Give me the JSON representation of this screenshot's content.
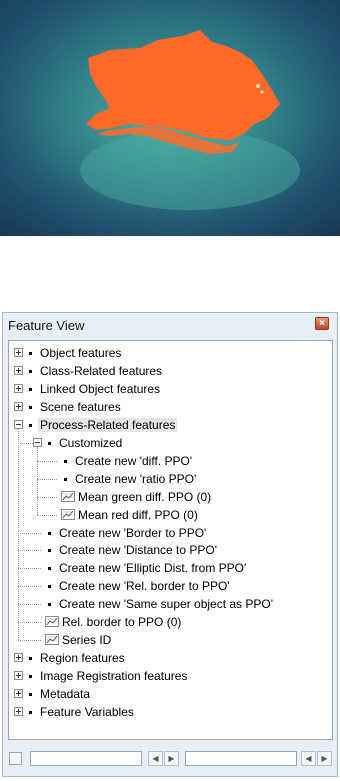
{
  "window": {
    "title": "Feature View",
    "close_icon": "close-icon"
  },
  "tree": {
    "items": [
      {
        "label": "Object features",
        "level": 0,
        "expander": "plus",
        "icon": "bullet"
      },
      {
        "label": "Class-Related features",
        "level": 0,
        "expander": "plus",
        "icon": "bullet"
      },
      {
        "label": "Linked Object features",
        "level": 0,
        "expander": "plus",
        "icon": "bullet"
      },
      {
        "label": "Scene features",
        "level": 0,
        "expander": "plus",
        "icon": "bullet"
      },
      {
        "label": "Process-Related features",
        "level": 0,
        "expander": "minus",
        "icon": "bullet",
        "highlighted": true
      },
      {
        "label": "Customized",
        "level": 1,
        "expander": "minus",
        "icon": "bullet"
      },
      {
        "label": "Create new 'diff. PPO'",
        "level": 2,
        "icon": "bullet"
      },
      {
        "label": "Create new 'ratio PPO'",
        "level": 2,
        "icon": "bullet"
      },
      {
        "label": "Mean green diff. PPO (0)",
        "level": 2,
        "icon": "feature-graph-icon"
      },
      {
        "label": "Mean red diff. PPO (0)",
        "level": 2,
        "icon": "feature-graph-icon"
      },
      {
        "label": "Create new 'Border to PPO'",
        "level": 1,
        "icon": "bullet"
      },
      {
        "label": "Create new 'Distance to PPO'",
        "level": 1,
        "icon": "bullet"
      },
      {
        "label": "Create new 'Elliptic Dist. from PPO'",
        "level": 1,
        "icon": "bullet"
      },
      {
        "label": "Create new 'Rel. border to PPO'",
        "level": 1,
        "icon": "bullet"
      },
      {
        "label": "Create new 'Same super object as PPO'",
        "level": 1,
        "icon": "bullet"
      },
      {
        "label": "Rel. border to PPO (0)",
        "level": 1,
        "icon": "feature-graph-icon"
      },
      {
        "label": "Series ID",
        "level": 1,
        "icon": "feature-graph-icon"
      },
      {
        "label": "Region features",
        "level": 0,
        "expander": "plus",
        "icon": "bullet"
      },
      {
        "label": "Image Registration features",
        "level": 0,
        "expander": "plus",
        "icon": "bullet"
      },
      {
        "label": "Metadata",
        "level": 0,
        "expander": "plus",
        "icon": "bullet"
      },
      {
        "label": "Feature Variables",
        "level": 0,
        "expander": "plus",
        "icon": "bullet"
      }
    ]
  },
  "bottom_bar": {
    "scroll_left_icon": "chevron-left-icon",
    "scroll_right_icon": "chevron-right-icon"
  },
  "colors": {
    "highlight_object": "#ff6a2a",
    "water_dark": "#1f3e5a",
    "water_shallow": "#3d9a97"
  }
}
